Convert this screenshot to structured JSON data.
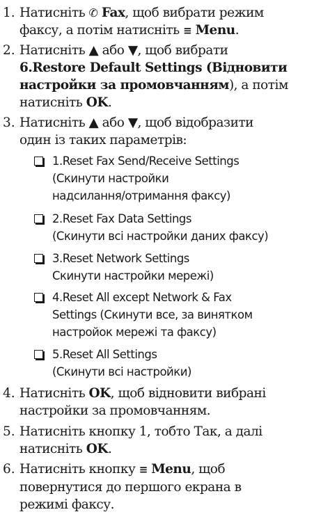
{
  "steps": [
    {
      "num": "1.",
      "lines": [
        {
          "a": "Натисніть ",
          "icon": "fax-icon",
          "b": "Fax",
          "c": ", щоб вибрати режим"
        },
        {
          "a": "факсу, а потім натисніть ",
          "icon": "menu-icon",
          "b": "Menu",
          "c": "."
        }
      ]
    },
    {
      "num": "2.",
      "lines": [
        {
          "a": "Натисніть ▲ або ▼, щоб вибрати"
        },
        {
          "b": "6.Restore Default Settings (Відновити"
        },
        {
          "b": "настройки за промовчанням",
          "c": "), а потім"
        },
        {
          "a": "натисніть ",
          "b": "OK",
          "c": "."
        }
      ]
    },
    {
      "num": "3.",
      "lines": [
        {
          "a": "Натисніть ▲ або ▼, щоб відобразити"
        },
        {
          "a": "один із таких параметрів:"
        }
      ]
    },
    {
      "num": "4.",
      "lines": [
        {
          "a": "Натисніть ",
          "b": "OK",
          "c": ", щоб відновити вибрані"
        },
        {
          "a": "настройки за промовчанням."
        }
      ]
    },
    {
      "num": "5.",
      "lines": [
        {
          "a": "Натисніть кнопку 1, тобто Так, а далі"
        },
        {
          "a": "натисніть ",
          "b": "OK",
          "c": "."
        }
      ]
    },
    {
      "num": "6.",
      "lines": [
        {
          "a": "Натисніть кнопку ",
          "icon": "menu-icon",
          "b": "Menu",
          "c": ", щоб"
        },
        {
          "a": "повернутися до першого екрана в"
        },
        {
          "a": "режимі факсу."
        }
      ]
    }
  ],
  "icons": {
    "fax-icon": "✆",
    "menu-icon": "≡"
  },
  "options": [
    {
      "lines": [
        "1.Reset Fax Send/Receive Settings",
        "(Скинути настройки",
        "надсилання/отримання факсу)"
      ]
    },
    {
      "lines": [
        "2.Reset Fax Data Settings",
        "(Скинути всі настройки даних факсу)"
      ]
    },
    {
      "lines": [
        "3.Reset Network Settings",
        "Скинути настройки мережі)"
      ]
    },
    {
      "lines": [
        "4.Reset All except Network & Fax",
        "Settings (Скинути все, за винятком",
        "настройок мережі та факсу)"
      ]
    },
    {
      "lines": [
        "5.Reset All Settings",
        "(Скинути всі настройки)"
      ]
    }
  ]
}
